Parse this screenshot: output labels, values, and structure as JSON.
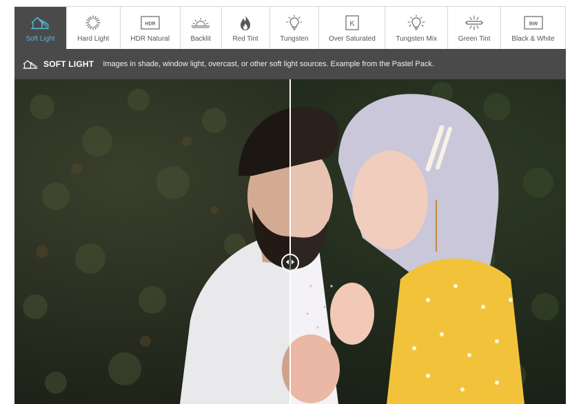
{
  "tabs": [
    {
      "label": "Soft Light",
      "icon": "house-shade-icon",
      "active": true
    },
    {
      "label": "Hard Light",
      "icon": "sunburst-icon",
      "active": false
    },
    {
      "label": "HDR Natural",
      "icon": "hdr-badge-icon",
      "badge": "HDR",
      "active": false
    },
    {
      "label": "Backlit",
      "icon": "sunset-icon",
      "active": false
    },
    {
      "label": "Red Tint",
      "icon": "flame-icon",
      "active": false
    },
    {
      "label": "Tungsten",
      "icon": "lightbulb-icon",
      "active": false
    },
    {
      "label": "Over Saturated",
      "icon": "k-badge-icon",
      "badge": "K",
      "active": false
    },
    {
      "label": "Tungsten Mix",
      "icon": "lightbulb-rays-icon",
      "active": false
    },
    {
      "label": "Green Tint",
      "icon": "fluorescent-tube-icon",
      "active": false
    },
    {
      "label": "Black & White",
      "icon": "bw-badge-icon",
      "badge": "BW",
      "active": false
    }
  ],
  "info": {
    "title": "SOFT LIGHT",
    "description": "Images in shade, window light, overcast, or other soft light sources. Example from the Pastel Pack."
  },
  "compare": {
    "split_position": 0.5
  },
  "colors": {
    "accent": "#57b6d0",
    "bar": "#4a4a4a",
    "border": "#d6d6d6",
    "icon": "#666666"
  }
}
